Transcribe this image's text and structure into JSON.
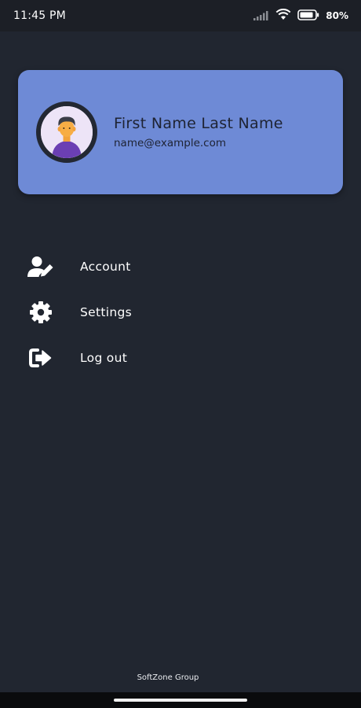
{
  "status_bar": {
    "time": "11:45 PM",
    "battery": "80%",
    "icons": [
      "signal-icon",
      "wifi-icon",
      "battery-icon"
    ]
  },
  "profile": {
    "name": "First Name Last Name",
    "email": "name@example.com",
    "card_color": "#6e8ad6",
    "avatar_icon": "user-avatar-icon"
  },
  "menu": {
    "items": [
      {
        "label": "Account",
        "icon": "user-edit-icon"
      },
      {
        "label": "Settings",
        "icon": "gear-icon"
      },
      {
        "label": "Log out",
        "icon": "logout-icon"
      }
    ]
  },
  "footer": {
    "text": "SoftZone Group"
  },
  "colors": {
    "background": "#212630",
    "status_bar": "#1c1f26",
    "accent": "#6e8ad6"
  }
}
